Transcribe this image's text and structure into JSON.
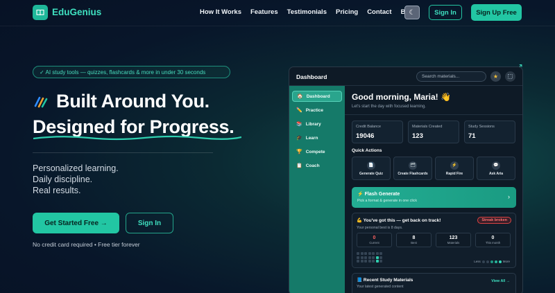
{
  "brand": {
    "name": "EduGenius"
  },
  "nav": {
    "links": [
      "How It Works",
      "Features",
      "Testimonials",
      "Pricing",
      "Contact",
      "Blog"
    ],
    "signin": "Sign In",
    "signup": "Sign Up Free"
  },
  "hero": {
    "badge": "✓  AI study tools — quizzes, flashcards & more in under 30 seconds",
    "line1": "Built Around You.",
    "line2": "Designed for Progress.",
    "tag1": "Personalized learning.",
    "tag2": "Daily discipline.",
    "tag3": "Real results.",
    "cta_primary": "Get Started Free  →",
    "cta_secondary": "Sign In",
    "note": "No credit card required • Free tier forever"
  },
  "dashboard": {
    "title": "Dashboard",
    "search_placeholder": "Search materials...",
    "sidebar": [
      {
        "label": "Dashboard",
        "icon": "🏠"
      },
      {
        "label": "Practice",
        "icon": "✏️"
      },
      {
        "label": "Library",
        "icon": "📚"
      },
      {
        "label": "Learn",
        "icon": "🎓"
      },
      {
        "label": "Compete",
        "icon": "🏆"
      },
      {
        "label": "Coach",
        "icon": "📋"
      }
    ],
    "greeting": "Good morning, Maria!  👋",
    "greeting_sub": "Let's start the day with focused learning.",
    "stats": [
      {
        "label": "Credit Balance",
        "value": "19046"
      },
      {
        "label": "Materials Created",
        "value": "123"
      },
      {
        "label": "Study Sessions",
        "value": "71"
      }
    ],
    "quick_actions_title": "Quick Actions",
    "quick_actions": [
      {
        "label": "Generate Quiz",
        "icon": "📄"
      },
      {
        "label": "Create Flashcards",
        "icon": "🗂"
      },
      {
        "label": "Rapid Fire",
        "icon": "⚡"
      },
      {
        "label": "Ask Aria",
        "icon": "💬"
      }
    ],
    "flash": {
      "title": "⚡ Flash Generate",
      "subtitle": "Pick a format & generate in one click",
      "arrow": "›"
    },
    "streak": {
      "title": "💪 You've got this — get back on track!",
      "subtitle": "Your personal best is 8 days.",
      "badge": "Streak broken",
      "boxes": [
        {
          "value": "0",
          "label": "Current"
        },
        {
          "value": "8",
          "label": "Best"
        },
        {
          "value": "123",
          "label": "Materials"
        },
        {
          "value": "0",
          "label": "This month"
        }
      ],
      "legend_less": "Less",
      "legend_more": "More"
    },
    "recent": {
      "title": "📘 Recent Study Materials",
      "subtitle": "Your latest generated content",
      "view_all": "View All →"
    }
  }
}
